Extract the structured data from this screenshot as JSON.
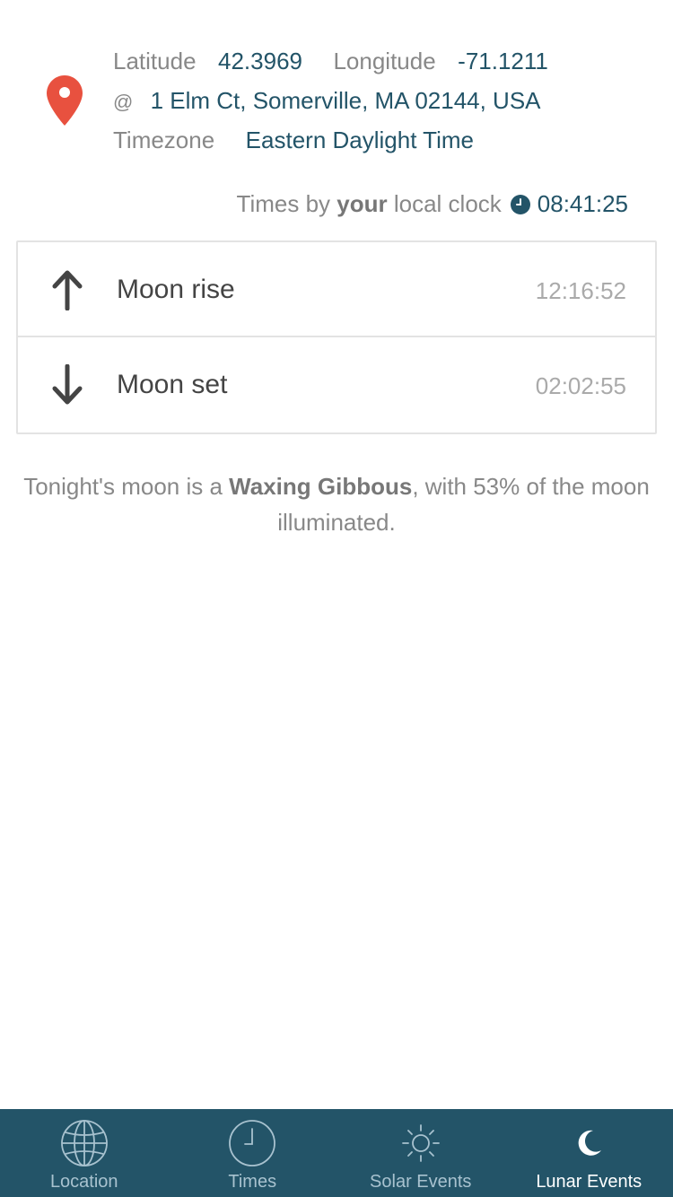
{
  "location": {
    "latitude_label": "Latitude",
    "latitude_value": "42.3969",
    "longitude_label": "Longitude",
    "longitude_value": "-71.1211",
    "at_symbol": "@",
    "address": "1 Elm Ct, Somerville, MA 02144, USA",
    "timezone_label": "Timezone",
    "timezone_value": "Eastern Daylight Time"
  },
  "clock": {
    "prefix": "Times by",
    "bold": "your",
    "suffix": "local clock",
    "time": "08:41:25"
  },
  "events": [
    {
      "label": "Moon rise",
      "time": "12:16:52",
      "icon": "arrow-up-icon"
    },
    {
      "label": "Moon set",
      "time": "02:02:55",
      "icon": "arrow-down-icon"
    }
  ],
  "moon": {
    "text_before": "Tonight's moon is a",
    "phase": "Waxing Gibbous",
    "text_after": ", with 53% of the moon illuminated."
  },
  "tabs": [
    {
      "label": "Location",
      "icon": "globe-icon",
      "active": false
    },
    {
      "label": "Times",
      "icon": "clock-icon",
      "active": false
    },
    {
      "label": "Solar Events",
      "icon": "sun-icon",
      "active": false
    },
    {
      "label": "Lunar Events",
      "icon": "moon-icon",
      "active": true
    }
  ],
  "colors": {
    "accent": "#235468",
    "pin": "#e8513f",
    "tabbar": "#235468"
  }
}
